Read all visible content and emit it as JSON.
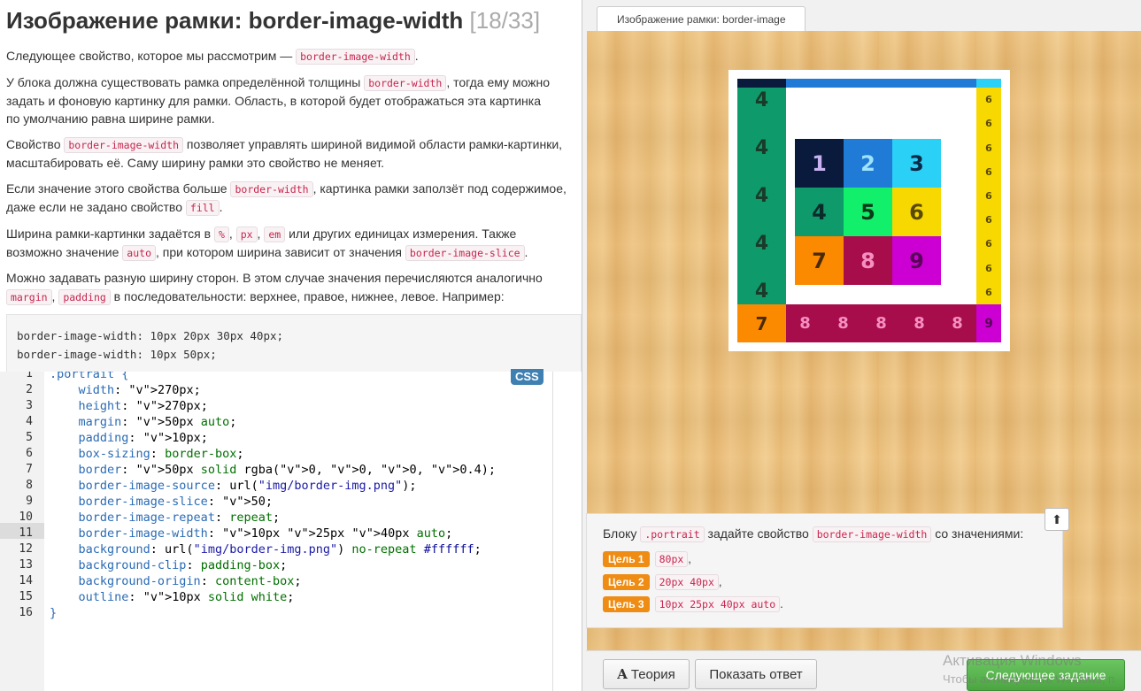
{
  "lesson": {
    "title": "Изображение рамки: border-image-width",
    "counter": "[18/33]",
    "p1_a": "Следующее свойство, которое мы рассмотрим — ",
    "p1_code": "border-image-width",
    "p1_b": ".",
    "p2_a": "У блока должна существовать рамка определённой толщины ",
    "p2_code": "border-width",
    "p2_b": ", тогда ему можно",
    "p2_c": "задать и фоновую картинку для рамки. Область, в которой будет отображаться эта картинка",
    "p2_d": "по умолчанию равна ширине рамки.",
    "p3_a": "Свойство ",
    "p3_code": "border-image-width",
    "p3_b": " позволяет управлять шириной видимой области рамки-картинки,",
    "p3_c": "масштабировать её. Саму ширину рамки это свойство не меняет.",
    "p4_a": "Если значение этого свойства больше ",
    "p4_code": "border-width",
    "p4_b": ", картинка рамки заползёт под содержимое,",
    "p4_c": "даже если не задано свойство ",
    "p4_code2": "fill",
    "p4_d": ".",
    "p5_a": "Ширина рамки-картинки задаётся в ",
    "p5_c1": "%",
    "p5_s1": ", ",
    "p5_c2": "px",
    "p5_s2": ", ",
    "p5_c3": "em",
    "p5_b": " или других единицах измерения. Также",
    "p5_d": "возможно значение ",
    "p5_c4": "auto",
    "p5_e": ", при котором ширина зависит от значения ",
    "p5_c5": "border-image-slice",
    "p5_f": ".",
    "p6_a": "Можно задавать разную ширину сторон. В этом случае значения перечисляются аналогично",
    "p6_c1": "margin",
    "p6_s": ", ",
    "p6_c2": "padding",
    "p6_b": " в последовательности: верхнее, правое, нижнее, левое. Например:",
    "example_1": "border-image-width: 10px 20px 30px 40px;",
    "example_2": "border-image-width: 10px 50px;"
  },
  "editor": {
    "lang_badge": "CSS",
    "active_line": 11,
    "line_numbers": [
      "1",
      "2",
      "3",
      "4",
      "5",
      "6",
      "7",
      "8",
      "9",
      "10",
      "11",
      "12",
      "13",
      "14",
      "15",
      "16"
    ],
    "lines": [
      ".portrait {",
      "    width: 270px;",
      "    height: 270px;",
      "    margin: 50px auto;",
      "    padding: 10px;",
      "    box-sizing: border-box;",
      "    border: 50px solid rgba(0, 0, 0, 0.4);",
      "    border-image-source: url(\"img/border-img.png\");",
      "    border-image-slice: 50;",
      "    border-image-repeat: repeat;",
      "    border-image-width: 10px 25px 40px auto;",
      "    background: url(\"img/border-img.png\") no-repeat #ffffff;",
      "    background-clip: padding-box;",
      "    background-origin: content-box;",
      "    outline: 10px solid white;",
      "}"
    ]
  },
  "preview": {
    "tab_label": "Изображение рамки: border-image",
    "grid_digits": [
      "1",
      "2",
      "3",
      "4",
      "5",
      "6",
      "7",
      "8",
      "9"
    ],
    "grid_colors": [
      "#0a1a3c",
      "#1f7bd6",
      "#2ad0f5",
      "#0f9a6c",
      "#12f06b",
      "#f7d800",
      "#fb8a00",
      "#a60d4a",
      "#cc00d2"
    ],
    "grid_text_colors": [
      "#c9b2f1",
      "#9ee3ff",
      "#0b2a4a",
      "#0b2a2a",
      "#0b3a1a",
      "#5a4a00",
      "#4a2a00",
      "#f58fc0",
      "#5a005a"
    ],
    "left_digits": [
      "4",
      "4",
      "4",
      "4",
      "4"
    ],
    "right_digits": [
      "6",
      "6",
      "6",
      "6",
      "6",
      "6",
      "6",
      "6",
      "6"
    ],
    "bottom_left_digit": "7",
    "bottom_digits": [
      "8",
      "8",
      "8",
      "8",
      "8"
    ],
    "bottom_right_digit": "9"
  },
  "task": {
    "text_a": "Блоку ",
    "code1": ".portrait",
    "text_b": " задайте свойство ",
    "code2": "border-image-width",
    "text_c": " со значениями:",
    "goals": [
      {
        "label": "Цель 1",
        "value": "80px",
        "after": ","
      },
      {
        "label": "Цель 2",
        "value": "20px 40px",
        "after": ","
      },
      {
        "label": "Цель 3",
        "value": "10px 25px 40px auto",
        "after": "."
      }
    ],
    "up_arrow": "⬆"
  },
  "buttons": {
    "theory_icon": "A",
    "theory": "Теория",
    "show_answer": "Показать ответ",
    "next": "Следующее задание"
  },
  "watermark": {
    "line1": "Активация Windows",
    "line2": "Чтобы активировать Windows, п"
  }
}
